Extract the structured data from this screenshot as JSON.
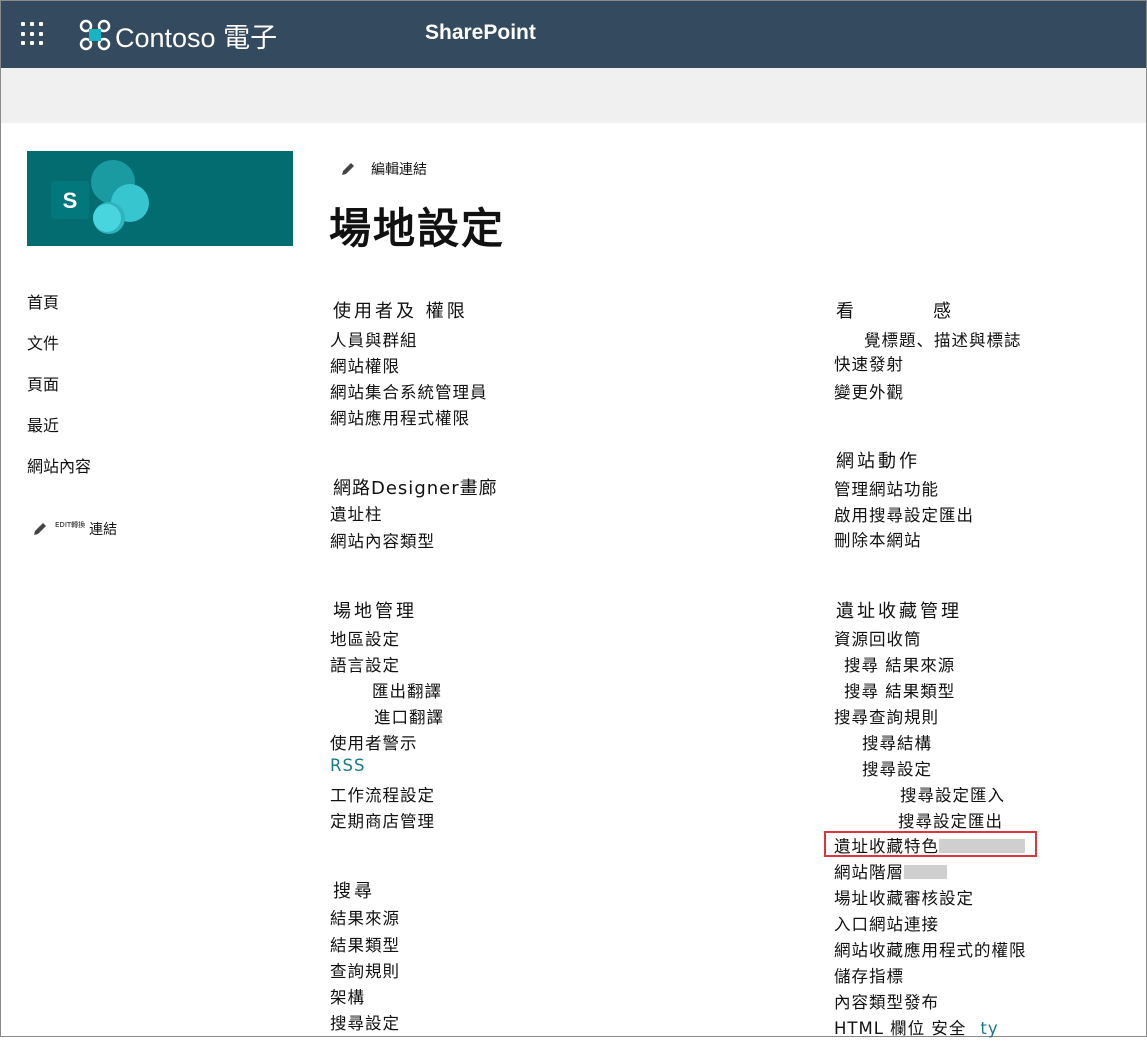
{
  "suite_bar": {
    "brand": "Contoso 電子",
    "app_name": "SharePoint"
  },
  "left_nav": {
    "items": [
      "首頁",
      "文件",
      "頁面",
      "最近",
      "網站內容"
    ],
    "edit_tiny": "EDIT轉換",
    "edit_label": "連結"
  },
  "header": {
    "edit_links": "編輯連結",
    "title": "場地設定"
  },
  "groups": {
    "users": {
      "title": "使用者及  權限",
      "links": [
        "人員與群組",
        "網站權限",
        "網站集合系統管理員",
        "網站應用程式權限"
      ]
    },
    "designer": {
      "title": "網路Designer畫廊",
      "links": [
        "遺址柱",
        "網站內容類型"
      ]
    },
    "admin": {
      "title": "場地管理",
      "links": [
        "地區設定",
        "語言設定",
        "匯出翻譯",
        "進口翻譯",
        "使用者警示",
        "RSS",
        "工作流程設定",
        "定期商店管理"
      ]
    },
    "search": {
      "title": "搜尋",
      "links": [
        "結果來源",
        "結果類型",
        "查詢規則",
        "架構",
        "搜尋設定"
      ]
    },
    "look": {
      "title_a": "看",
      "title_b": "感",
      "links": [
        "覺標題、描述與標誌",
        "快速發射",
        "變更外觀"
      ]
    },
    "actions": {
      "title": "網站動作",
      "links": [
        "管理網站功能",
        "啟用搜尋設定匯出",
        "刪除本網站"
      ]
    },
    "collection": {
      "title": "遺址收藏管理",
      "links": [
        "資源回收筒",
        "搜尋   結果來源",
        "搜尋   結果類型",
        "搜尋查詢規則",
        "搜尋結構",
        "搜尋設定",
        "搜尋設定匯入",
        "搜尋設定匯出",
        "遺址收藏特色",
        "網站階層",
        "場址收藏審核設定",
        "入口網站連接",
        "網站收藏應用程式的權限",
        "儲存指標",
        "內容類型發布",
        "HTML 欄位   安全"
      ],
      "last_suffix": "ty"
    }
  },
  "colors": {
    "suite_bar": "#344a5e",
    "site_logo": "#036c70",
    "highlight": "#d9363e",
    "link_accent": "#1a7a8a"
  }
}
